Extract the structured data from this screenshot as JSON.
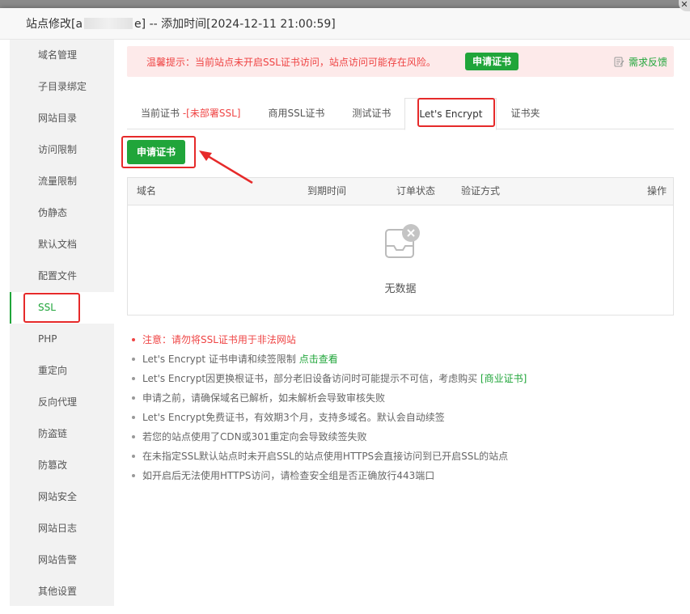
{
  "window": {
    "title_prefix": "站点修改[a",
    "title_suffix": "e] -- 添加时间[2024-12-11 21:00:59]",
    "close_glyph": "✕"
  },
  "sidebar": {
    "items": [
      {
        "label": "域名管理"
      },
      {
        "label": "子目录绑定"
      },
      {
        "label": "网站目录"
      },
      {
        "label": "访问限制"
      },
      {
        "label": "流量限制"
      },
      {
        "label": "伪静态"
      },
      {
        "label": "默认文档"
      },
      {
        "label": "配置文件"
      },
      {
        "label": "SSL",
        "active": true
      },
      {
        "label": "PHP"
      },
      {
        "label": "重定向"
      },
      {
        "label": "反向代理"
      },
      {
        "label": "防盗链"
      },
      {
        "label": "防篡改"
      },
      {
        "label": "网站安全"
      },
      {
        "label": "网站日志"
      },
      {
        "label": "网站告警"
      },
      {
        "label": "其他设置"
      }
    ]
  },
  "alert": {
    "text": "温馨提示：当前站点未开启SSL证书访问，站点访问可能存在风险。",
    "button_label": "申请证书",
    "feedback_label": "需求反馈"
  },
  "tabs": [
    {
      "label": "当前证书",
      "warn": " -[未部署SSL]"
    },
    {
      "label": "商用SSL证书"
    },
    {
      "label": "测试证书"
    },
    {
      "label": "Let's Encrypt",
      "active": true
    },
    {
      "label": "证书夹"
    }
  ],
  "apply_button": "申请证书",
  "table": {
    "columns": [
      "域名",
      "到期时间",
      "订单状态",
      "验证方式",
      "操作"
    ],
    "empty_text": "无数据"
  },
  "notes": [
    {
      "text": "注意：请勿将SSL证书用于非法网站",
      "danger": true
    },
    {
      "text": "Let's Encrypt 证书申请和续签限制 ",
      "link": "点击查看"
    },
    {
      "text": "Let's Encrypt因更换根证书，部分老旧设备访问时可能提示不可信，考虑购买 ",
      "link": "[商业证书]"
    },
    {
      "text": "申请之前，请确保域名已解析，如未解析会导致审核失败"
    },
    {
      "text": "Let's Encrypt免费证书，有效期3个月，支持多域名。默认会自动续签"
    },
    {
      "text": "若您的站点使用了CDN或301重定向会导致续签失败"
    },
    {
      "text": "在未指定SSL默认站点时未开启SSL的站点使用HTTPS会直接访问到已开启SSL的站点"
    },
    {
      "text": "如开启后无法使用HTTPS访问，请检查安全组是否正确放行443端口"
    }
  ],
  "colors": {
    "accent": "#20a53a",
    "danger": "#ef4444",
    "highlight": "#e62a2a"
  }
}
